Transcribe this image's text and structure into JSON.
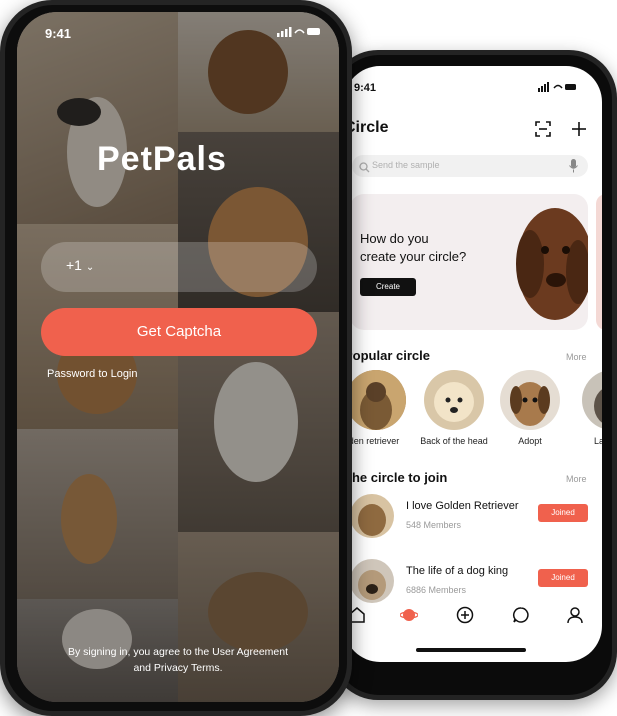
{
  "back_screen": {
    "status_time": "9:41",
    "title": "Circle",
    "search_placeholder": "Send the sample",
    "banner": {
      "title_line1": "How do you",
      "title_line2": "create your circle?",
      "button": "Create"
    },
    "popular": {
      "heading": "Popular circle",
      "more": "More",
      "items": [
        {
          "label": "Golden retriever"
        },
        {
          "label": "Back of the head"
        },
        {
          "label": "Adopt"
        },
        {
          "label": "Labrador"
        }
      ]
    },
    "join": {
      "heading": "The circle to join",
      "more": "More",
      "items": [
        {
          "name": "I love Golden Retriever",
          "members": "548 Members",
          "button": "Joined"
        },
        {
          "name": "The life of a dog king",
          "members": "6886 Members",
          "button": "Joined"
        }
      ]
    },
    "tabs": [
      "home-icon",
      "planet-icon",
      "plus-circle-icon",
      "chat-icon",
      "profile-icon"
    ],
    "accent_color": "#f0614d"
  },
  "front_screen": {
    "status_time": "9:41",
    "logo": "PetPals",
    "country_code": "+1",
    "captcha_button": "Get Captcha",
    "password_login": "Password to Login",
    "agreement_line1": "By signing in, you agree to the User Agreement",
    "agreement_line2": "and Privacy Terms.",
    "accent_color": "#f0614d"
  }
}
